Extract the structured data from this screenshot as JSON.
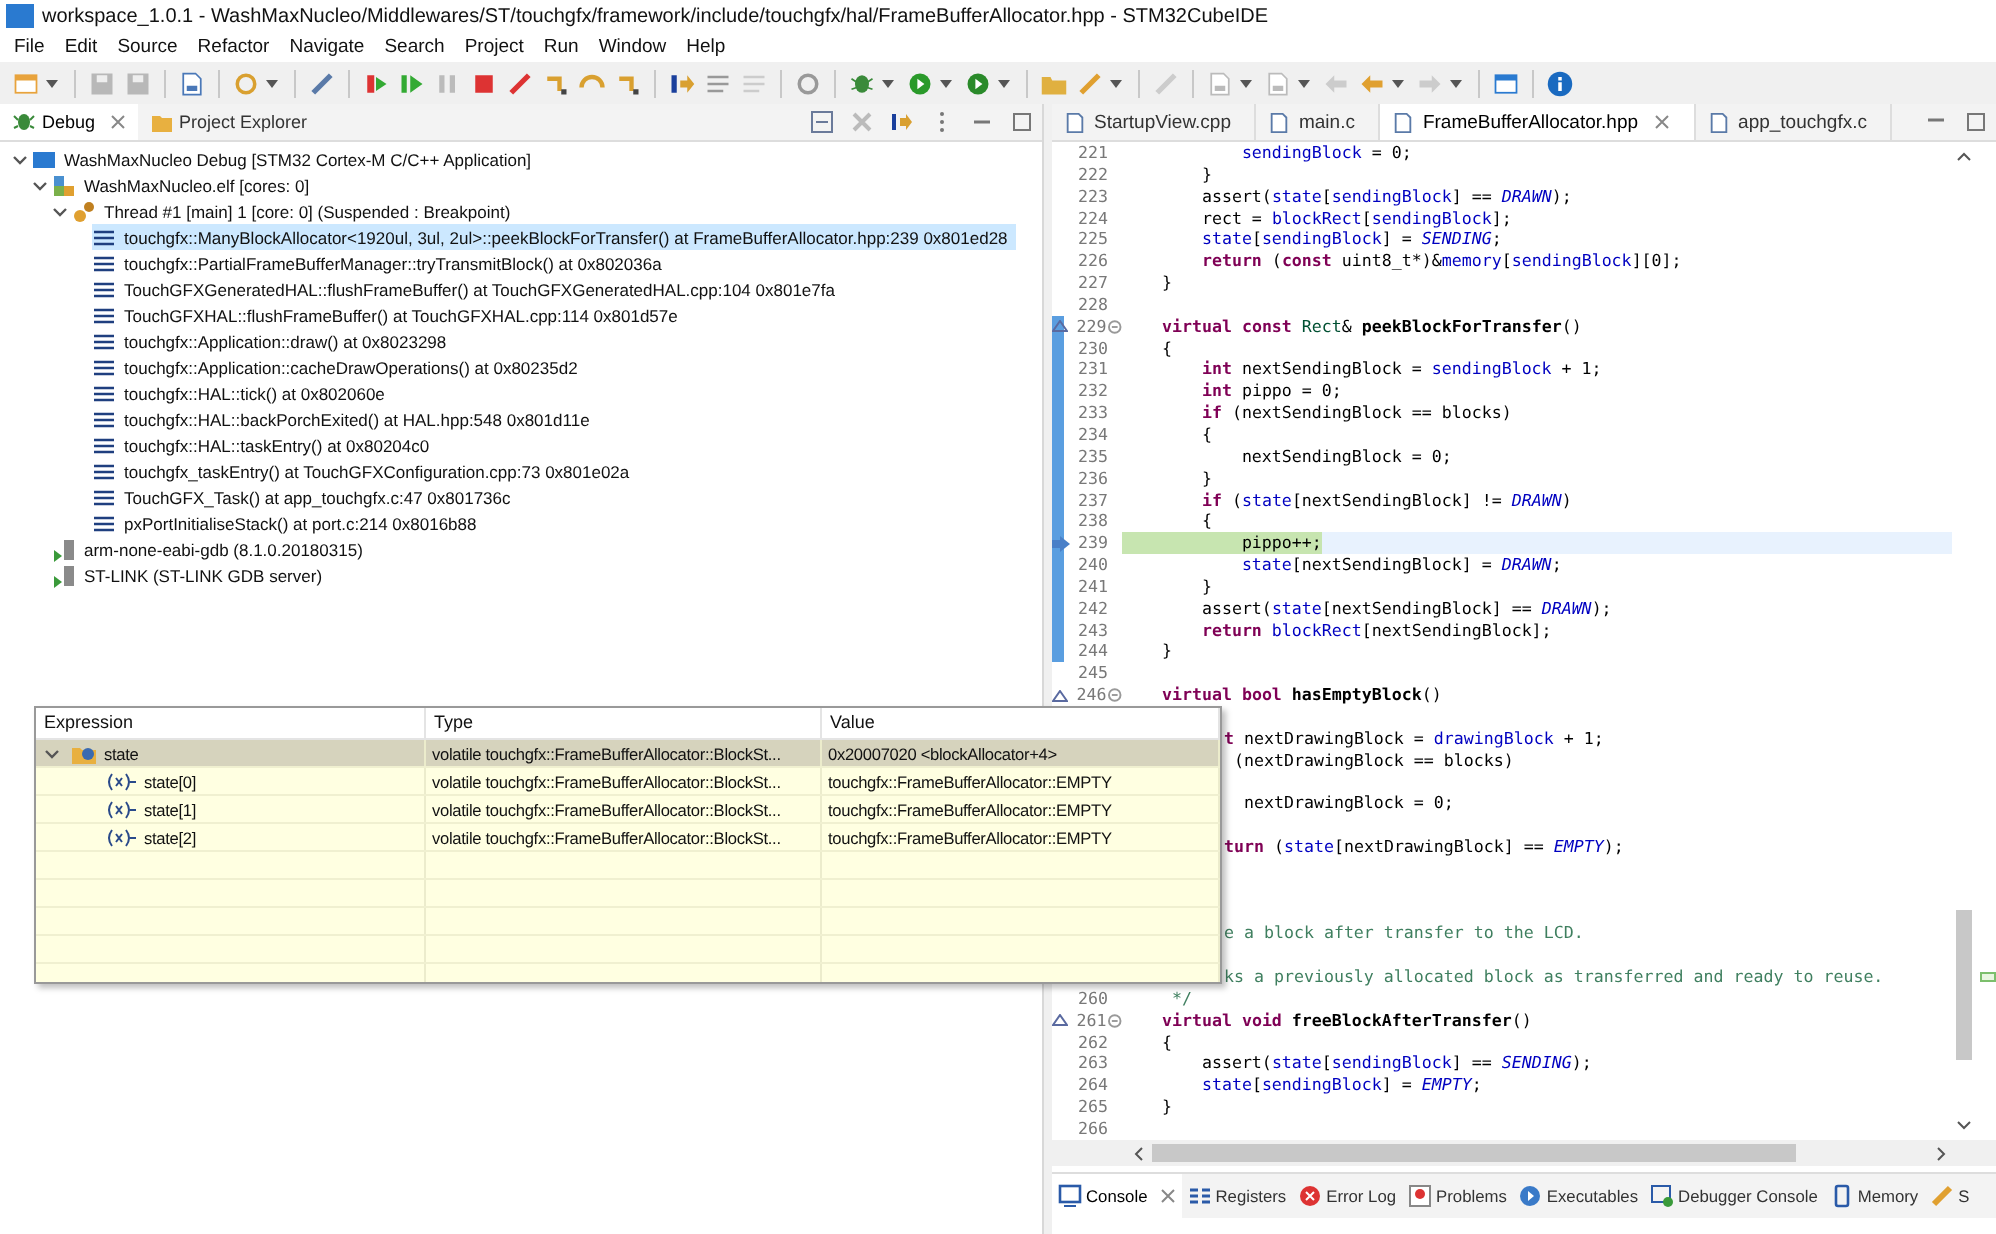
{
  "window": {
    "title": "workspace_1.0.1 - WashMaxNucleo/Middlewares/ST/touchgfx/framework/include/touchgfx/hal/FrameBufferAllocator.hpp - STM32CubeIDE"
  },
  "menu": [
    "File",
    "Edit",
    "Source",
    "Refactor",
    "Navigate",
    "Search",
    "Project",
    "Run",
    "Window",
    "Help"
  ],
  "debug_view": {
    "tabs": [
      {
        "label": "Debug",
        "selected": true
      },
      {
        "label": "Project Explorer",
        "selected": false
      }
    ],
    "tree": [
      {
        "kind": "launch",
        "label": "WashMaxNucleo Debug [STM32 Cortex-M C/C++ Application]",
        "expanded": true,
        "selected": false,
        "children": [
          {
            "kind": "process",
            "label": "WashMaxNucleo.elf [cores: 0]",
            "expanded": true,
            "selected": false,
            "children": [
              {
                "kind": "thread",
                "label": "Thread #1 [main] 1 [core: 0] (Suspended : Breakpoint)",
                "expanded": true,
                "selected": false,
                "children": [
                  {
                    "kind": "frame",
                    "label": "touchgfx::ManyBlockAllocator<1920ul, 3ul, 2ul>::peekBlockForTransfer() at FrameBufferAllocator.hpp:239 0x801ed28",
                    "selected": true
                  },
                  {
                    "kind": "frame",
                    "label": "touchgfx::PartialFrameBufferManager::tryTransmitBlock() at 0x802036a",
                    "selected": false
                  },
                  {
                    "kind": "frame",
                    "label": "TouchGFXGeneratedHAL::flushFrameBuffer() at TouchGFXGeneratedHAL.cpp:104 0x801e7fa",
                    "selected": false
                  },
                  {
                    "kind": "frame",
                    "label": "TouchGFXHAL::flushFrameBuffer() at TouchGFXHAL.cpp:114 0x801d57e",
                    "selected": false
                  },
                  {
                    "kind": "frame",
                    "label": "touchgfx::Application::draw() at 0x8023298",
                    "selected": false
                  },
                  {
                    "kind": "frame",
                    "label": "touchgfx::Application::cacheDrawOperations() at 0x80235d2",
                    "selected": false
                  },
                  {
                    "kind": "frame",
                    "label": "touchgfx::HAL::tick() at 0x802060e",
                    "selected": false
                  },
                  {
                    "kind": "frame",
                    "label": "touchgfx::HAL::backPorchExited() at HAL.hpp:548 0x801d11e",
                    "selected": false
                  },
                  {
                    "kind": "frame",
                    "label": "touchgfx::HAL::taskEntry() at 0x80204c0",
                    "selected": false
                  },
                  {
                    "kind": "frame",
                    "label": "touchgfx_taskEntry() at TouchGFXConfiguration.cpp:73 0x801e02a",
                    "selected": false
                  },
                  {
                    "kind": "frame",
                    "label": "TouchGFX_Task() at app_touchgfx.c:47 0x801736c",
                    "selected": false
                  },
                  {
                    "kind": "frame",
                    "label": "pxPortInitialiseStack() at port.c:214 0x8016b88",
                    "selected": false
                  }
                ]
              }
            ]
          },
          {
            "kind": "debugger",
            "label": "arm-none-eabi-gdb (8.1.0.20180315)",
            "selected": false
          },
          {
            "kind": "debugger",
            "label": "ST-LINK (ST-LINK GDB server)",
            "selected": false
          }
        ]
      }
    ]
  },
  "expressions": {
    "columns": [
      "Expression",
      "Type",
      "Value"
    ],
    "rows": [
      {
        "kind": "pointer",
        "name": "state",
        "type": "volatile touchgfx::FrameBufferAllocator::BlockSt...",
        "value": "0x20007020 <blockAllocator+4>",
        "expanded": true,
        "selected": true,
        "children": [
          {
            "kind": "variable",
            "name": "state[0]",
            "type": "volatile touchgfx::FrameBufferAllocator::BlockSt...",
            "value": "touchgfx::FrameBufferAllocator::EMPTY",
            "selected": false
          },
          {
            "kind": "variable",
            "name": "state[1]",
            "type": "volatile touchgfx::FrameBufferAllocator::BlockSt...",
            "value": "touchgfx::FrameBufferAllocator::EMPTY",
            "selected": false
          },
          {
            "kind": "variable",
            "name": "state[2]",
            "type": "volatile touchgfx::FrameBufferAllocator::BlockSt...",
            "value": "touchgfx::FrameBufferAllocator::EMPTY",
            "selected": false
          }
        ]
      }
    ]
  },
  "editor": {
    "tabs": [
      {
        "label": "StartupView.cpp",
        "selected": false
      },
      {
        "label": "main.c",
        "selected": false
      },
      {
        "label": "FrameBufferAllocator.hpp",
        "selected": true
      },
      {
        "label": "app_touchgfx.c",
        "selected": false
      }
    ],
    "lines": [
      {
        "kind": "code",
        "number": "221",
        "range": false,
        "current": false,
        "tokens": [
          {
            "kind": "field",
            "text": "            sendingBlock"
          },
          {
            "kind": "plain",
            "text": " = 0;"
          }
        ]
      },
      {
        "kind": "code",
        "number": "222",
        "range": false,
        "current": false,
        "tokens": [
          {
            "kind": "plain",
            "text": "        }"
          }
        ]
      },
      {
        "kind": "code",
        "number": "223",
        "range": false,
        "current": false,
        "tokens": [
          {
            "kind": "plain",
            "text": "        assert("
          },
          {
            "kind": "field",
            "text": "state"
          },
          {
            "kind": "plain",
            "text": "["
          },
          {
            "kind": "field",
            "text": "sendingBlock"
          },
          {
            "kind": "plain",
            "text": "] == "
          },
          {
            "kind": "enum",
            "text": "DRAWN"
          },
          {
            "kind": "plain",
            "text": ");"
          }
        ]
      },
      {
        "kind": "code",
        "number": "224",
        "range": false,
        "current": false,
        "tokens": [
          {
            "kind": "plain",
            "text": "        rect = "
          },
          {
            "kind": "field",
            "text": "blockRect"
          },
          {
            "kind": "plain",
            "text": "["
          },
          {
            "kind": "field",
            "text": "sendingBlock"
          },
          {
            "kind": "plain",
            "text": "];"
          }
        ]
      },
      {
        "kind": "code",
        "number": "225",
        "range": false,
        "current": false,
        "tokens": [
          {
            "kind": "field",
            "text": "        state"
          },
          {
            "kind": "plain",
            "text": "["
          },
          {
            "kind": "field",
            "text": "sendingBlock"
          },
          {
            "kind": "plain",
            "text": "] = "
          },
          {
            "kind": "enum",
            "text": "SENDING"
          },
          {
            "kind": "plain",
            "text": ";"
          }
        ]
      },
      {
        "kind": "code",
        "number": "226",
        "range": false,
        "current": false,
        "tokens": [
          {
            "kind": "keyword",
            "text": "        return"
          },
          {
            "kind": "plain",
            "text": " ("
          },
          {
            "kind": "keyword",
            "text": "const"
          },
          {
            "kind": "plain",
            "text": " uint8_t*)&"
          },
          {
            "kind": "field",
            "text": "memory"
          },
          {
            "kind": "plain",
            "text": "["
          },
          {
            "kind": "field",
            "text": "sendingBlock"
          },
          {
            "kind": "plain",
            "text": "][0];"
          }
        ]
      },
      {
        "kind": "code",
        "number": "227",
        "range": false,
        "current": false,
        "tokens": [
          {
            "kind": "plain",
            "text": "    }"
          }
        ]
      },
      {
        "kind": "code",
        "number": "228",
        "range": false,
        "current": false
      },
      {
        "kind": "code",
        "number": "229",
        "range": true,
        "current": false,
        "overrides": true,
        "tokens": [
          {
            "kind": "keyword",
            "text": "    virtual"
          },
          {
            "kind": "keyword",
            "text": " const"
          },
          {
            "kind": "type",
            "text": " Rect"
          },
          {
            "kind": "plain",
            "text": "& "
          },
          {
            "kind": "declaration",
            "text": "peekBlockForTransfer"
          },
          {
            "kind": "plain",
            "text": "()"
          }
        ]
      },
      {
        "kind": "code",
        "number": "230",
        "range": true,
        "current": false,
        "tokens": [
          {
            "kind": "plain",
            "text": "    {"
          }
        ]
      },
      {
        "kind": "code",
        "number": "231",
        "range": true,
        "current": false,
        "tokens": [
          {
            "kind": "keyword",
            "text": "        int"
          },
          {
            "kind": "plain",
            "text": " nextSendingBlock = "
          },
          {
            "kind": "field",
            "text": "sendingBlock"
          },
          {
            "kind": "plain",
            "text": " + 1;"
          }
        ]
      },
      {
        "kind": "code",
        "number": "232",
        "range": true,
        "current": false,
        "tokens": [
          {
            "kind": "keyword",
            "text": "        int"
          },
          {
            "kind": "plain",
            "text": " pippo = 0;"
          }
        ]
      },
      {
        "kind": "code",
        "number": "233",
        "range": true,
        "current": false,
        "tokens": [
          {
            "kind": "keyword",
            "text": "        if"
          },
          {
            "kind": "plain",
            "text": " (nextSendingBlock == blocks)"
          }
        ]
      },
      {
        "kind": "code",
        "number": "234",
        "range": true,
        "current": false,
        "tokens": [
          {
            "kind": "plain",
            "text": "        {"
          }
        ]
      },
      {
        "kind": "code",
        "number": "235",
        "range": true,
        "current": false,
        "tokens": [
          {
            "kind": "plain",
            "text": "            nextSendingBlock = 0;"
          }
        ]
      },
      {
        "kind": "code",
        "number": "236",
        "range": true,
        "current": false,
        "tokens": [
          {
            "kind": "plain",
            "text": "        }"
          }
        ]
      },
      {
        "kind": "code",
        "number": "237",
        "range": true,
        "current": false,
        "tokens": [
          {
            "kind": "keyword",
            "text": "        if"
          },
          {
            "kind": "plain",
            "text": " ("
          },
          {
            "kind": "field",
            "text": "state"
          },
          {
            "kind": "plain",
            "text": "[nextSendingBlock] != "
          },
          {
            "kind": "enum",
            "text": "DRAWN"
          },
          {
            "kind": "plain",
            "text": ")"
          }
        ]
      },
      {
        "kind": "code",
        "number": "238",
        "range": true,
        "current": false,
        "tokens": [
          {
            "kind": "plain",
            "text": "        {"
          }
        ]
      },
      {
        "kind": "code",
        "number": "239",
        "range": true,
        "current": true,
        "instruction_pointer": true,
        "tokens": [
          {
            "kind": "plain",
            "text": "            pippo++;"
          }
        ]
      },
      {
        "kind": "code",
        "number": "240",
        "range": true,
        "current": false,
        "tokens": [
          {
            "kind": "field",
            "text": "            state"
          },
          {
            "kind": "plain",
            "text": "[nextSendingBlock] = "
          },
          {
            "kind": "enum",
            "text": "DRAWN"
          },
          {
            "kind": "plain",
            "text": ";"
          }
        ]
      },
      {
        "kind": "code",
        "number": "241",
        "range": true,
        "current": false,
        "tokens": [
          {
            "kind": "plain",
            "text": "        }"
          }
        ]
      },
      {
        "kind": "code",
        "number": "242",
        "range": true,
        "current": false,
        "tokens": [
          {
            "kind": "plain",
            "text": "        assert("
          },
          {
            "kind": "field",
            "text": "state"
          },
          {
            "kind": "plain",
            "text": "[nextSendingBlock] == "
          },
          {
            "kind": "enum",
            "text": "DRAWN"
          },
          {
            "kind": "plain",
            "text": ");"
          }
        ]
      },
      {
        "kind": "code",
        "number": "243",
        "range": true,
        "current": false,
        "tokens": [
          {
            "kind": "keyword",
            "text": "        return"
          },
          {
            "kind": "field",
            "text": " blockRect"
          },
          {
            "kind": "plain",
            "text": "[nextSendingBlock];"
          }
        ]
      },
      {
        "kind": "code",
        "number": "244",
        "range": true,
        "current": false,
        "tokens": [
          {
            "kind": "plain",
            "text": "    }"
          }
        ]
      },
      {
        "kind": "code",
        "number": "245",
        "range": false,
        "current": false
      },
      {
        "kind": "code",
        "number": "246",
        "range": false,
        "current": false,
        "overrides": true,
        "tokens": [
          {
            "kind": "keyword",
            "text": "    virtual"
          },
          {
            "kind": "keyword",
            "text": " bool"
          },
          {
            "kind": "declaration",
            "text": " hasEmptyBlock"
          },
          {
            "kind": "plain",
            "text": "()"
          }
        ]
      },
      {
        "kind": "covered"
      },
      {
        "kind": "partial",
        "tokens": [
          {
            "kind": "keyword",
            "text": "t"
          },
          {
            "kind": "plain",
            "text": " nextDrawingBlock = "
          },
          {
            "kind": "field",
            "text": "drawingBlock"
          },
          {
            "kind": "plain",
            "text": " + 1;"
          }
        ]
      },
      {
        "kind": "partial",
        "tokens": [
          {
            "kind": "plain",
            "text": " (nextDrawingBlock == blocks)"
          }
        ]
      },
      {
        "kind": "covered"
      },
      {
        "kind": "partial",
        "tokens": [
          {
            "kind": "plain",
            "text": "  nextDrawingBlock = 0;"
          }
        ]
      },
      {
        "kind": "covered"
      },
      {
        "kind": "partial",
        "tokens": [
          {
            "kind": "keyword",
            "text": "turn"
          },
          {
            "kind": "plain",
            "text": " ("
          },
          {
            "kind": "field",
            "text": "state"
          },
          {
            "kind": "plain",
            "text": "[nextDrawingBlock] == "
          },
          {
            "kind": "enum",
            "text": "EMPTY"
          },
          {
            "kind": "plain",
            "text": ");"
          }
        ]
      },
      {
        "kind": "covered"
      },
      {
        "kind": "covered"
      },
      {
        "kind": "covered"
      },
      {
        "kind": "partial",
        "tokens": [
          {
            "kind": "comment",
            "text": "e a block after transfer to the LCD."
          }
        ]
      },
      {
        "kind": "covered"
      },
      {
        "kind": "partial",
        "tokens": [
          {
            "kind": "comment",
            "text": "ks a previously allocated block as transferred and ready to reuse."
          }
        ]
      },
      {
        "kind": "code",
        "number": "260",
        "range": false,
        "current": false,
        "tokens": [
          {
            "kind": "comment",
            "text": "     */"
          }
        ]
      },
      {
        "kind": "code",
        "number": "261",
        "range": false,
        "current": false,
        "overrides": true,
        "tokens": [
          {
            "kind": "keyword",
            "text": "    virtual"
          },
          {
            "kind": "keyword",
            "text": " void"
          },
          {
            "kind": "declaration",
            "text": " freeBlockAfterTransfer"
          },
          {
            "kind": "plain",
            "text": "()"
          }
        ]
      },
      {
        "kind": "code",
        "number": "262",
        "range": false,
        "current": false,
        "tokens": [
          {
            "kind": "plain",
            "text": "    {"
          }
        ]
      },
      {
        "kind": "code",
        "number": "263",
        "range": false,
        "current": false,
        "tokens": [
          {
            "kind": "plain",
            "text": "        assert("
          },
          {
            "kind": "field",
            "text": "state"
          },
          {
            "kind": "plain",
            "text": "["
          },
          {
            "kind": "field",
            "text": "sendingBlock"
          },
          {
            "kind": "plain",
            "text": "] == "
          },
          {
            "kind": "enum",
            "text": "SENDING"
          },
          {
            "kind": "plain",
            "text": ");"
          }
        ]
      },
      {
        "kind": "code",
        "number": "264",
        "range": false,
        "current": false,
        "tokens": [
          {
            "kind": "field",
            "text": "        state"
          },
          {
            "kind": "plain",
            "text": "["
          },
          {
            "kind": "field",
            "text": "sendingBlock"
          },
          {
            "kind": "plain",
            "text": "] = "
          },
          {
            "kind": "enum",
            "text": "EMPTY"
          },
          {
            "kind": "plain",
            "text": ";"
          }
        ]
      },
      {
        "kind": "code",
        "number": "265",
        "range": false,
        "current": false,
        "tokens": [
          {
            "kind": "plain",
            "text": "    }"
          }
        ]
      },
      {
        "kind": "code",
        "number": "266",
        "range": false,
        "current": false
      }
    ]
  },
  "bottom_tabs": [
    {
      "kind": "console",
      "label": "Console",
      "selected": true
    },
    {
      "kind": "registers",
      "label": "Registers",
      "selected": false
    },
    {
      "kind": "error-log",
      "label": "Error Log",
      "selected": false
    },
    {
      "kind": "problems",
      "label": "Problems",
      "selected": false
    },
    {
      "kind": "executables",
      "label": "Executables",
      "selected": false
    },
    {
      "kind": "debugger-console",
      "label": "Debugger Console",
      "selected": false
    },
    {
      "kind": "memory",
      "label": "Memory",
      "selected": false
    },
    {
      "kind": "static-stack",
      "label": "S",
      "selected": false
    }
  ]
}
